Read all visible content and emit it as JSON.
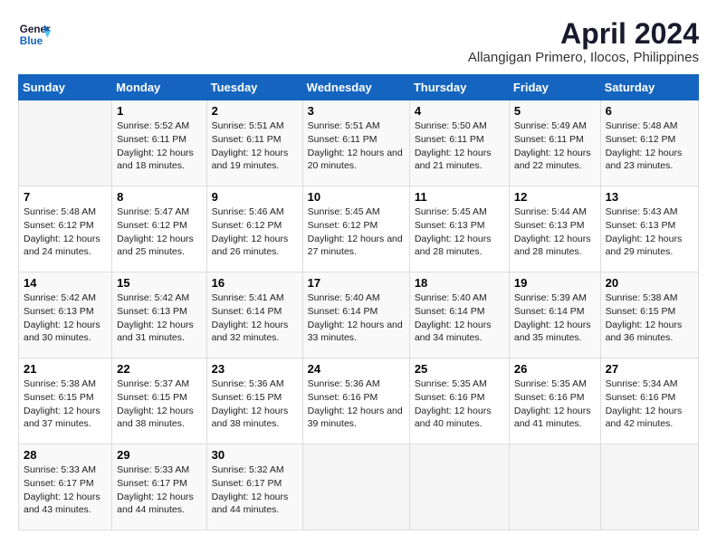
{
  "header": {
    "logo_line1": "General",
    "logo_line2": "Blue",
    "month_title": "April 2024",
    "location": "Allangigan Primero, Ilocos, Philippines"
  },
  "weekdays": [
    "Sunday",
    "Monday",
    "Tuesday",
    "Wednesday",
    "Thursday",
    "Friday",
    "Saturday"
  ],
  "weeks": [
    [
      {
        "day": "",
        "sunrise": "",
        "sunset": "",
        "daylight": ""
      },
      {
        "day": "1",
        "sunrise": "Sunrise: 5:52 AM",
        "sunset": "Sunset: 6:11 PM",
        "daylight": "Daylight: 12 hours and 18 minutes."
      },
      {
        "day": "2",
        "sunrise": "Sunrise: 5:51 AM",
        "sunset": "Sunset: 6:11 PM",
        "daylight": "Daylight: 12 hours and 19 minutes."
      },
      {
        "day": "3",
        "sunrise": "Sunrise: 5:51 AM",
        "sunset": "Sunset: 6:11 PM",
        "daylight": "Daylight: 12 hours and 20 minutes."
      },
      {
        "day": "4",
        "sunrise": "Sunrise: 5:50 AM",
        "sunset": "Sunset: 6:11 PM",
        "daylight": "Daylight: 12 hours and 21 minutes."
      },
      {
        "day": "5",
        "sunrise": "Sunrise: 5:49 AM",
        "sunset": "Sunset: 6:11 PM",
        "daylight": "Daylight: 12 hours and 22 minutes."
      },
      {
        "day": "6",
        "sunrise": "Sunrise: 5:48 AM",
        "sunset": "Sunset: 6:12 PM",
        "daylight": "Daylight: 12 hours and 23 minutes."
      }
    ],
    [
      {
        "day": "7",
        "sunrise": "Sunrise: 5:48 AM",
        "sunset": "Sunset: 6:12 PM",
        "daylight": "Daylight: 12 hours and 24 minutes."
      },
      {
        "day": "8",
        "sunrise": "Sunrise: 5:47 AM",
        "sunset": "Sunset: 6:12 PM",
        "daylight": "Daylight: 12 hours and 25 minutes."
      },
      {
        "day": "9",
        "sunrise": "Sunrise: 5:46 AM",
        "sunset": "Sunset: 6:12 PM",
        "daylight": "Daylight: 12 hours and 26 minutes."
      },
      {
        "day": "10",
        "sunrise": "Sunrise: 5:45 AM",
        "sunset": "Sunset: 6:12 PM",
        "daylight": "Daylight: 12 hours and 27 minutes."
      },
      {
        "day": "11",
        "sunrise": "Sunrise: 5:45 AM",
        "sunset": "Sunset: 6:13 PM",
        "daylight": "Daylight: 12 hours and 28 minutes."
      },
      {
        "day": "12",
        "sunrise": "Sunrise: 5:44 AM",
        "sunset": "Sunset: 6:13 PM",
        "daylight": "Daylight: 12 hours and 28 minutes."
      },
      {
        "day": "13",
        "sunrise": "Sunrise: 5:43 AM",
        "sunset": "Sunset: 6:13 PM",
        "daylight": "Daylight: 12 hours and 29 minutes."
      }
    ],
    [
      {
        "day": "14",
        "sunrise": "Sunrise: 5:42 AM",
        "sunset": "Sunset: 6:13 PM",
        "daylight": "Daylight: 12 hours and 30 minutes."
      },
      {
        "day": "15",
        "sunrise": "Sunrise: 5:42 AM",
        "sunset": "Sunset: 6:13 PM",
        "daylight": "Daylight: 12 hours and 31 minutes."
      },
      {
        "day": "16",
        "sunrise": "Sunrise: 5:41 AM",
        "sunset": "Sunset: 6:14 PM",
        "daylight": "Daylight: 12 hours and 32 minutes."
      },
      {
        "day": "17",
        "sunrise": "Sunrise: 5:40 AM",
        "sunset": "Sunset: 6:14 PM",
        "daylight": "Daylight: 12 hours and 33 minutes."
      },
      {
        "day": "18",
        "sunrise": "Sunrise: 5:40 AM",
        "sunset": "Sunset: 6:14 PM",
        "daylight": "Daylight: 12 hours and 34 minutes."
      },
      {
        "day": "19",
        "sunrise": "Sunrise: 5:39 AM",
        "sunset": "Sunset: 6:14 PM",
        "daylight": "Daylight: 12 hours and 35 minutes."
      },
      {
        "day": "20",
        "sunrise": "Sunrise: 5:38 AM",
        "sunset": "Sunset: 6:15 PM",
        "daylight": "Daylight: 12 hours and 36 minutes."
      }
    ],
    [
      {
        "day": "21",
        "sunrise": "Sunrise: 5:38 AM",
        "sunset": "Sunset: 6:15 PM",
        "daylight": "Daylight: 12 hours and 37 minutes."
      },
      {
        "day": "22",
        "sunrise": "Sunrise: 5:37 AM",
        "sunset": "Sunset: 6:15 PM",
        "daylight": "Daylight: 12 hours and 38 minutes."
      },
      {
        "day": "23",
        "sunrise": "Sunrise: 5:36 AM",
        "sunset": "Sunset: 6:15 PM",
        "daylight": "Daylight: 12 hours and 38 minutes."
      },
      {
        "day": "24",
        "sunrise": "Sunrise: 5:36 AM",
        "sunset": "Sunset: 6:16 PM",
        "daylight": "Daylight: 12 hours and 39 minutes."
      },
      {
        "day": "25",
        "sunrise": "Sunrise: 5:35 AM",
        "sunset": "Sunset: 6:16 PM",
        "daylight": "Daylight: 12 hours and 40 minutes."
      },
      {
        "day": "26",
        "sunrise": "Sunrise: 5:35 AM",
        "sunset": "Sunset: 6:16 PM",
        "daylight": "Daylight: 12 hours and 41 minutes."
      },
      {
        "day": "27",
        "sunrise": "Sunrise: 5:34 AM",
        "sunset": "Sunset: 6:16 PM",
        "daylight": "Daylight: 12 hours and 42 minutes."
      }
    ],
    [
      {
        "day": "28",
        "sunrise": "Sunrise: 5:33 AM",
        "sunset": "Sunset: 6:17 PM",
        "daylight": "Daylight: 12 hours and 43 minutes."
      },
      {
        "day": "29",
        "sunrise": "Sunrise: 5:33 AM",
        "sunset": "Sunset: 6:17 PM",
        "daylight": "Daylight: 12 hours and 44 minutes."
      },
      {
        "day": "30",
        "sunrise": "Sunrise: 5:32 AM",
        "sunset": "Sunset: 6:17 PM",
        "daylight": "Daylight: 12 hours and 44 minutes."
      },
      {
        "day": "",
        "sunrise": "",
        "sunset": "",
        "daylight": ""
      },
      {
        "day": "",
        "sunrise": "",
        "sunset": "",
        "daylight": ""
      },
      {
        "day": "",
        "sunrise": "",
        "sunset": "",
        "daylight": ""
      },
      {
        "day": "",
        "sunrise": "",
        "sunset": "",
        "daylight": ""
      }
    ]
  ]
}
